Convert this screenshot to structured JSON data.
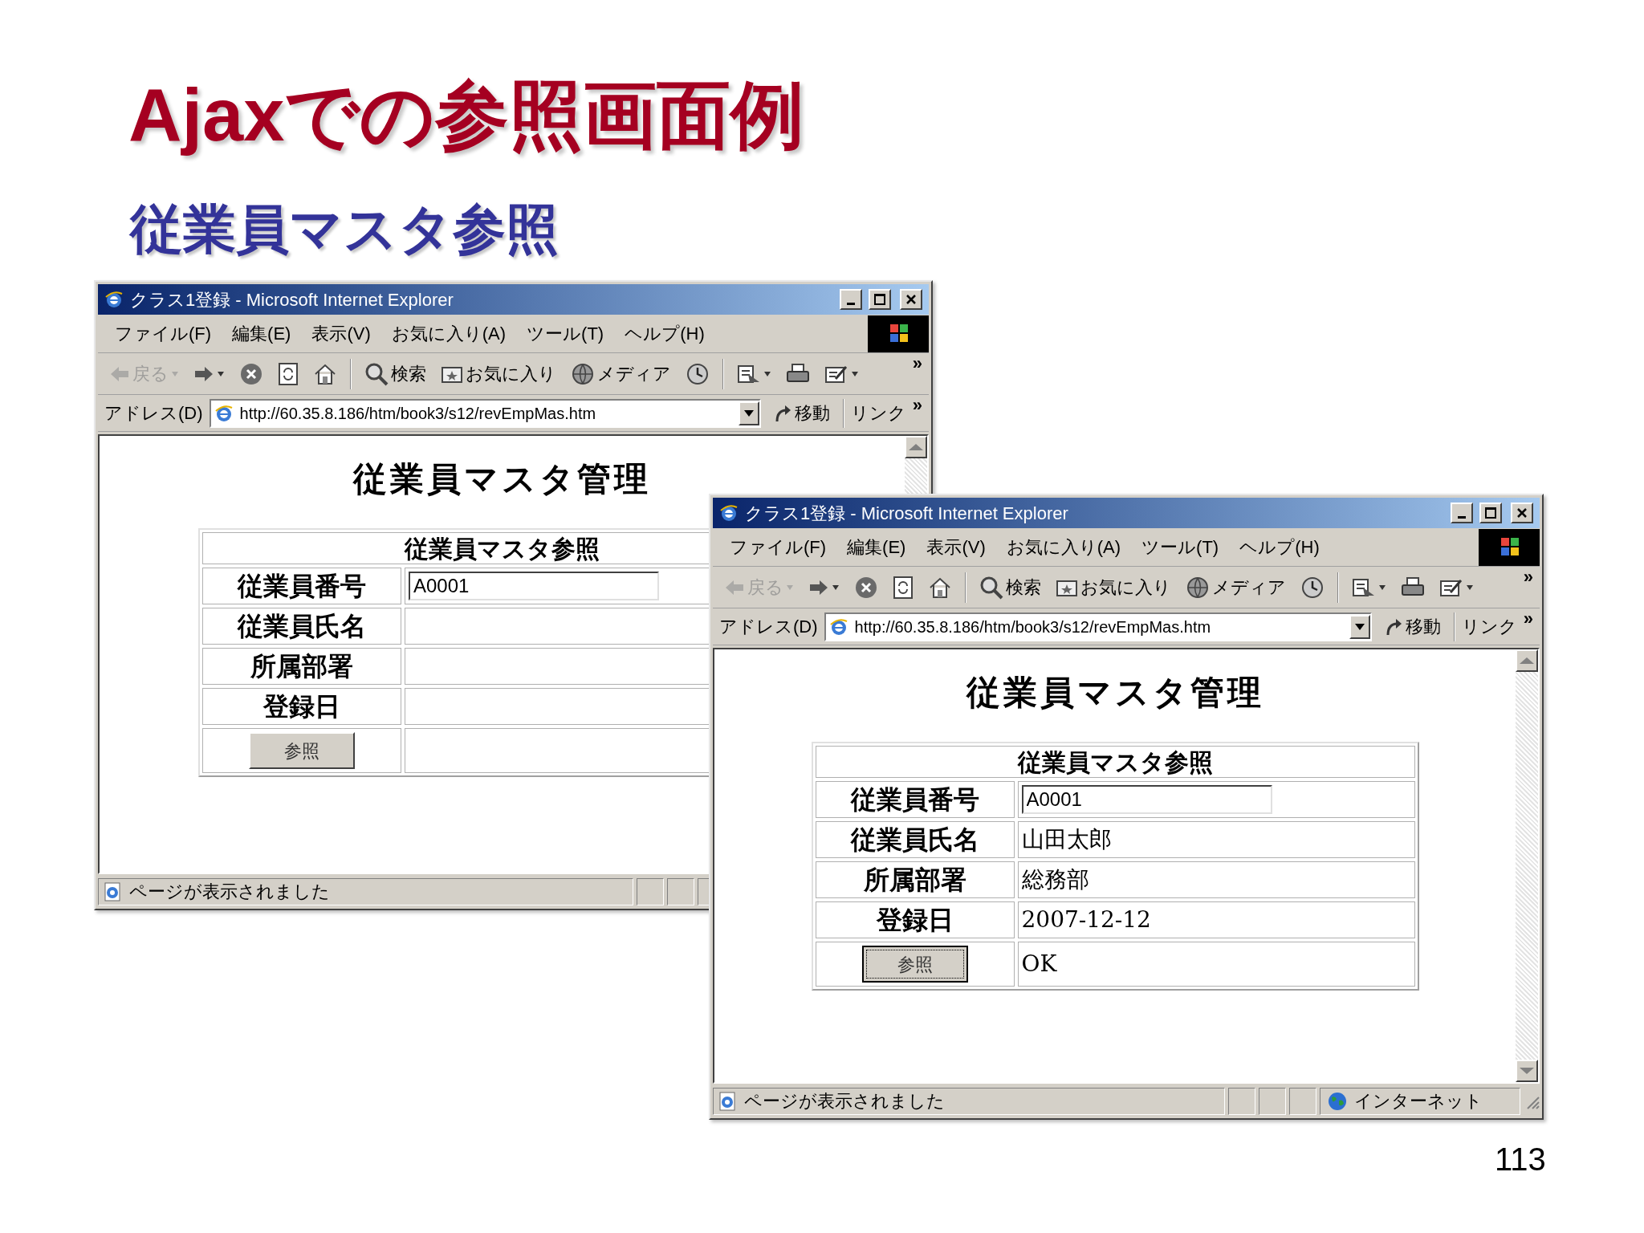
{
  "slide": {
    "title": "Ajaxでの参照画面例",
    "subtitle": "従業員マスタ参照",
    "page_number": "113"
  },
  "windows": [
    {
      "title": "クラス1登録 - Microsoft Internet Explorer",
      "menu": [
        "ファイル(F)",
        "編集(E)",
        "表示(V)",
        "お気に入り(A)",
        "ツール(T)",
        "ヘルプ(H)"
      ],
      "toolbar": [
        {
          "kind": "back",
          "label": "戻る",
          "disabled": true
        },
        {
          "kind": "forward",
          "disabled": false
        },
        {
          "kind": "stop",
          "disabled": false
        },
        {
          "kind": "refresh",
          "disabled": false
        },
        {
          "kind": "home",
          "disabled": false
        },
        {
          "kind": "search",
          "label": "検索",
          "disabled": false
        },
        {
          "kind": "favorites",
          "label": "お気に入り",
          "disabled": false
        },
        {
          "kind": "media",
          "label": "メディア",
          "disabled": false
        },
        {
          "kind": "history",
          "disabled": false
        },
        {
          "kind": "mail",
          "disabled": false
        },
        {
          "kind": "print",
          "disabled": false
        },
        {
          "kind": "edit",
          "disabled": false
        },
        {
          "kind": "more",
          "label": "»",
          "disabled": false
        }
      ],
      "address": {
        "label": "アドレス(D)",
        "url": "http://60.35.8.186/htm/book3/s12/revEmpMas.htm",
        "go": "移動",
        "links": "リンク",
        "more": "»"
      },
      "page": {
        "heading": "従業員マスタ管理",
        "table_title": "従業員マスタ参照",
        "rows": [
          {
            "kind": "input",
            "label": "従業員番号",
            "value": "A0001"
          },
          {
            "kind": "text",
            "label": "従業員氏名"
          },
          {
            "kind": "text",
            "label": "所属部署"
          },
          {
            "kind": "text",
            "label": "登録日"
          },
          {
            "kind": "button",
            "button": "参照",
            "focused": false
          }
        ]
      },
      "status": {
        "text": "ページが表示されました"
      }
    },
    {
      "title": "クラス1登録 - Microsoft Internet Explorer",
      "menu": [
        "ファイル(F)",
        "編集(E)",
        "表示(V)",
        "お気に入り(A)",
        "ツール(T)",
        "ヘルプ(H)"
      ],
      "toolbar": [
        {
          "kind": "back",
          "label": "戻る",
          "disabled": true
        },
        {
          "kind": "forward",
          "disabled": false
        },
        {
          "kind": "stop",
          "disabled": false
        },
        {
          "kind": "refresh",
          "disabled": false
        },
        {
          "kind": "home",
          "disabled": false
        },
        {
          "kind": "search",
          "label": "検索",
          "disabled": false
        },
        {
          "kind": "favorites",
          "label": "お気に入り",
          "disabled": false
        },
        {
          "kind": "media",
          "label": "メディア",
          "disabled": false
        },
        {
          "kind": "history",
          "disabled": false
        },
        {
          "kind": "mail",
          "disabled": false
        },
        {
          "kind": "print",
          "disabled": false
        },
        {
          "kind": "edit",
          "disabled": false
        },
        {
          "kind": "more",
          "label": "»",
          "disabled": false
        }
      ],
      "address": {
        "label": "アドレス(D)",
        "url": "http://60.35.8.186/htm/book3/s12/revEmpMas.htm",
        "go": "移動",
        "links": "リンク",
        "more": "»"
      },
      "page": {
        "heading": "従業員マスタ管理",
        "table_title": "従業員マスタ参照",
        "rows": [
          {
            "kind": "input",
            "label": "従業員番号",
            "value": "A0001"
          },
          {
            "kind": "text",
            "label": "従業員氏名",
            "value": "山田太郎"
          },
          {
            "kind": "text",
            "label": "所属部署",
            "value": "総務部"
          },
          {
            "kind": "text",
            "label": "登録日",
            "value": "2007-12-12"
          },
          {
            "kind": "button",
            "button": "参照",
            "value": "OK",
            "focused": true
          }
        ]
      },
      "status": {
        "text": "ページが表示されました",
        "zone": "インターネット"
      }
    }
  ]
}
